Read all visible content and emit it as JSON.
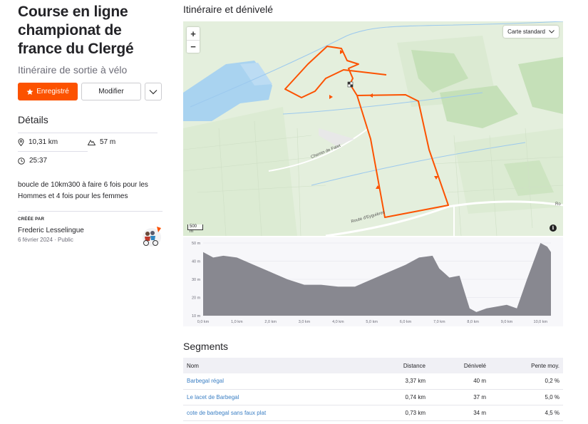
{
  "route": {
    "title": "Course en ligne championat de france du Clergé",
    "subtitle": "Itinéraire de sortie à vélo"
  },
  "actions": {
    "save_label": "Enregistré",
    "edit_label": "Modifier"
  },
  "details": {
    "title": "Détails",
    "distance": "10,31 km",
    "elevation": "57 m",
    "time": "25:37",
    "description": "boucle de 10km300 à faire 6 fois pour les Hommes et 4 fois pour les femmes"
  },
  "creator": {
    "label": "CRÉÉE PAR",
    "name": "Frederic Lesselingue",
    "date": "6 février 2024",
    "visibility": "Public"
  },
  "map": {
    "title": "Itinéraire et dénivelé",
    "zoom_in": "+",
    "zoom_out": "−",
    "style_label": "Carte standard",
    "scale_label": "500 m",
    "info_label": "i",
    "road_labels": [
      "Chemin de Fatet",
      "Route d'Eyguières",
      "Ro"
    ],
    "colors": {
      "route": "#fc5200",
      "water": "#a9d3f0",
      "land": "#e4efdd"
    }
  },
  "elevation_chart": {
    "y_ticks": [
      "50 m",
      "40 m",
      "30 m",
      "20 m",
      "10 m"
    ],
    "x_ticks": [
      "0,0 km",
      "1,0 km",
      "2,0 km",
      "3,0 km",
      "4,0 km",
      "5,0 km",
      "6,0 km",
      "7,0 km",
      "8,0 km",
      "9,0 km",
      "10,0 km"
    ],
    "profile_km": [
      0,
      0.3,
      0.6,
      1.0,
      1.5,
      2.0,
      2.5,
      3.0,
      3.5,
      4.0,
      4.5,
      5.0,
      5.5,
      6.0,
      6.4,
      6.8,
      7.0,
      7.3,
      7.6,
      7.9,
      8.1,
      8.4,
      8.7,
      9.0,
      9.3,
      9.6,
      10.0,
      10.2,
      10.31
    ],
    "profile_m": [
      45,
      42,
      43,
      42,
      38,
      34,
      30,
      27,
      27,
      26,
      26,
      30,
      34,
      38,
      42,
      43,
      36,
      31,
      32,
      14,
      12,
      14,
      15,
      16,
      14,
      30,
      50,
      48,
      45
    ],
    "y_range": [
      10,
      50
    ],
    "x_range": [
      0,
      10.31
    ],
    "color": "#888890"
  },
  "segments": {
    "title": "Segments",
    "headers": {
      "name": "Nom",
      "distance": "Distance",
      "elevation": "Dénivelé",
      "grade": "Pente moy."
    },
    "rows": [
      {
        "name": "Barbegal régal",
        "distance": "3,37 km",
        "elevation": "40 m",
        "grade": "0,2 %"
      },
      {
        "name": "Le lacet de Barbegal",
        "distance": "0,74 km",
        "elevation": "37 m",
        "grade": "5,0 %"
      },
      {
        "name": "cote de barbegal sans faux plat",
        "distance": "0,73 km",
        "elevation": "34 m",
        "grade": "4,5 %"
      }
    ]
  }
}
